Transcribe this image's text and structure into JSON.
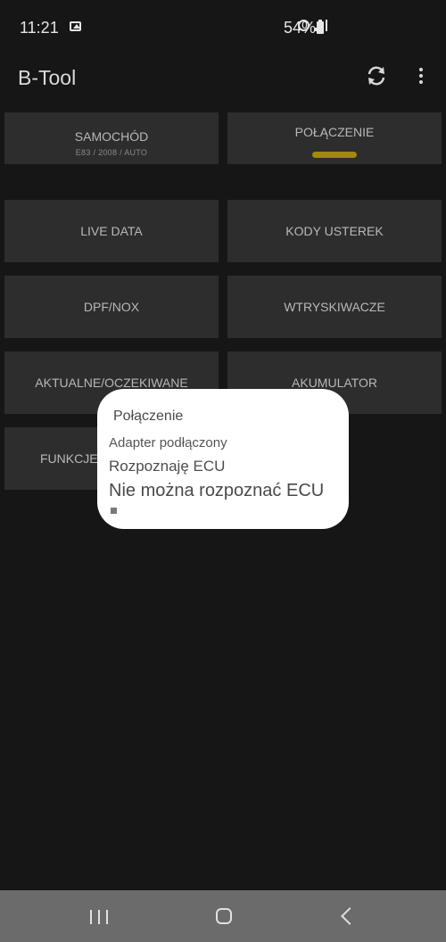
{
  "status_bar": {
    "time": "11:21",
    "battery": "54%",
    "icons": [
      "gallery-icon",
      "alarm-icon",
      "signal-icon",
      "battery-icon"
    ]
  },
  "app_bar": {
    "title": "B-Tool",
    "icons": [
      "refresh-icon",
      "overflow-menu-icon"
    ]
  },
  "tiles": {
    "car": {
      "label": "SAMOCHÓD",
      "sub": "E83 / 2008 / AUTO"
    },
    "connection": {
      "label": "POŁĄCZENIE",
      "indicator_color": "#c8a800"
    },
    "live_data": {
      "label": "LIVE DATA"
    },
    "error_codes": {
      "label": "KODY USTEREK"
    },
    "dpf": {
      "label": "DPF/NOX"
    },
    "injectors": {
      "label": "WTRYSKIWACZE"
    },
    "actual_expected": {
      "label": "AKTUALNE/OCZEKIWANE"
    },
    "battery": {
      "label": "AKUMULATOR"
    },
    "functions": {
      "label": "FUNKCJE"
    }
  },
  "dialog": {
    "title": "Połączenie",
    "line1": "Adapter podłączony",
    "line2": "Rozpoznaję ECU",
    "line3": "Nie można rozpoznać ECU",
    "stop_icon": "stop-icon"
  },
  "nav_bar": {
    "icons": [
      "recent-apps-icon",
      "home-icon",
      "back-icon"
    ]
  }
}
